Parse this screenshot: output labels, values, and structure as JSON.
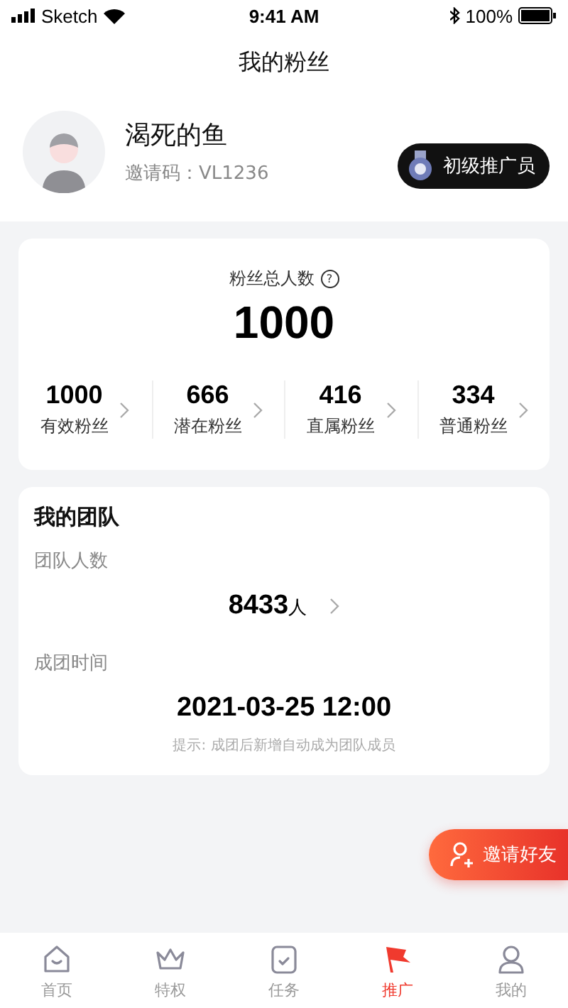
{
  "status_bar": {
    "carrier": "Sketch",
    "time": "9:41 AM",
    "battery": "100%"
  },
  "title": "我的粉丝",
  "profile": {
    "name": "渴死的鱼",
    "invite_code": "邀请码：VL1236",
    "badge": "初级推广员"
  },
  "fans": {
    "label": "粉丝总人数",
    "help": "?",
    "total": "1000",
    "stats": [
      {
        "value": "1000",
        "label": "有效粉丝"
      },
      {
        "value": "666",
        "label": "潜在粉丝"
      },
      {
        "value": "416",
        "label": "直属粉丝"
      },
      {
        "value": "334",
        "label": "普通粉丝"
      }
    ]
  },
  "team": {
    "title": "我的团队",
    "count_label": "团队人数",
    "count": "8433",
    "count_unit": "人",
    "time_label": "成团时间",
    "time": "2021-03-25 12:00",
    "hint": "提示: 成团后新增自动成为团队成员"
  },
  "invite_button": "邀请好友",
  "tabs": [
    {
      "kind": "home",
      "label": "首页",
      "selected": false
    },
    {
      "kind": "crown",
      "label": "特权",
      "selected": false
    },
    {
      "kind": "task",
      "label": "任务",
      "selected": false
    },
    {
      "kind": "flag",
      "label": "推广",
      "selected": true
    },
    {
      "kind": "user",
      "label": "我的",
      "selected": false
    }
  ]
}
